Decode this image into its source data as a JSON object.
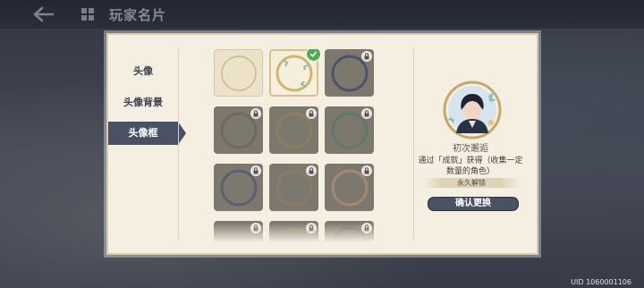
{
  "header": {
    "title": "玩家名片"
  },
  "tabs": [
    {
      "label": "头像"
    },
    {
      "label": "头像背景"
    },
    {
      "label": "头像框"
    }
  ],
  "frames": [
    {
      "state": "unlocked"
    },
    {
      "state": "selected"
    },
    {
      "state": "locked"
    },
    {
      "state": "locked"
    },
    {
      "state": "locked"
    },
    {
      "state": "locked"
    },
    {
      "state": "locked"
    },
    {
      "state": "locked"
    },
    {
      "state": "locked"
    },
    {
      "state": "locked"
    },
    {
      "state": "locked"
    },
    {
      "state": "locked"
    }
  ],
  "detail": {
    "name": "初次邂逅",
    "description": "通过「成就」获得（收集一定数量的角色）",
    "duration": "永久解锁",
    "confirm_label": "确认更换"
  },
  "footer": {
    "uid": "UID 1060001106"
  },
  "colors": {
    "accent": "#4a5164",
    "panel": "#f4efe1",
    "check": "#4caf50"
  }
}
